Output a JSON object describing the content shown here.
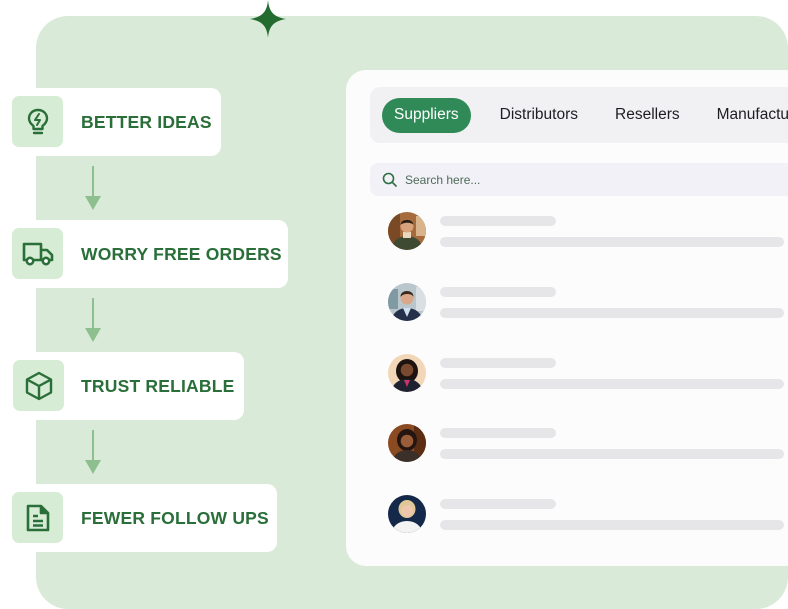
{
  "features": [
    {
      "label": "BETTER IDEAS",
      "icon": "lightbulb-bolt-icon"
    },
    {
      "label": "WORRY FREE ORDERS",
      "icon": "truck-icon"
    },
    {
      "label": "TRUST RELIABLE",
      "icon": "box-icon"
    },
    {
      "label": "FEWER FOLLOW UPS",
      "icon": "document-icon"
    }
  ],
  "tabs": [
    {
      "label": "Suppliers",
      "active": true
    },
    {
      "label": "Distributors",
      "active": false
    },
    {
      "label": "Resellers",
      "active": false
    },
    {
      "label": "Manufacturers",
      "active": false
    }
  ],
  "search": {
    "placeholder": "Search here...",
    "value": ""
  },
  "contacts": [
    {
      "avatar": "avatar-man-green-sweater"
    },
    {
      "avatar": "avatar-man-navy-blazer"
    },
    {
      "avatar": "avatar-woman-pink-top"
    },
    {
      "avatar": "avatar-woman-dark-top"
    },
    {
      "avatar": "avatar-woman-blonde-white-shirt"
    }
  ],
  "colors": {
    "brand_green": "#2a6e39",
    "active_tab": "#2f8a57",
    "panel_bg": "#d9ebd8",
    "icon_box_bg": "#d6ecd4",
    "skeleton": "#e6e6e9"
  }
}
